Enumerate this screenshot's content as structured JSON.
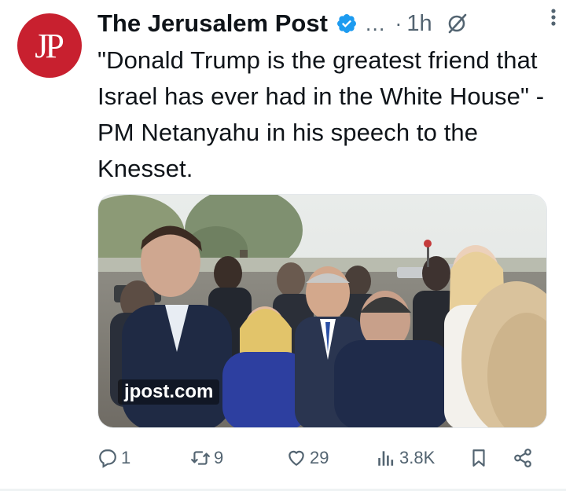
{
  "author": {
    "name": "The Jerusalem Post",
    "avatar_text": "JP",
    "handle_truncated": "...",
    "separator": "·",
    "time": "1h",
    "verified": true
  },
  "tweet": {
    "text": "\"Donald Trump is the greatest friend that Israel has ever had in the White House\" - PM Netanyahu in his speech to the Knesset."
  },
  "media": {
    "watermark": "jpost.com"
  },
  "actions": {
    "replies": "1",
    "retweets": "9",
    "likes": "29",
    "views": "3.8K"
  },
  "colors": {
    "avatar_bg": "#c8202f",
    "verified": "#1d9bf0",
    "muted": "#536471"
  }
}
